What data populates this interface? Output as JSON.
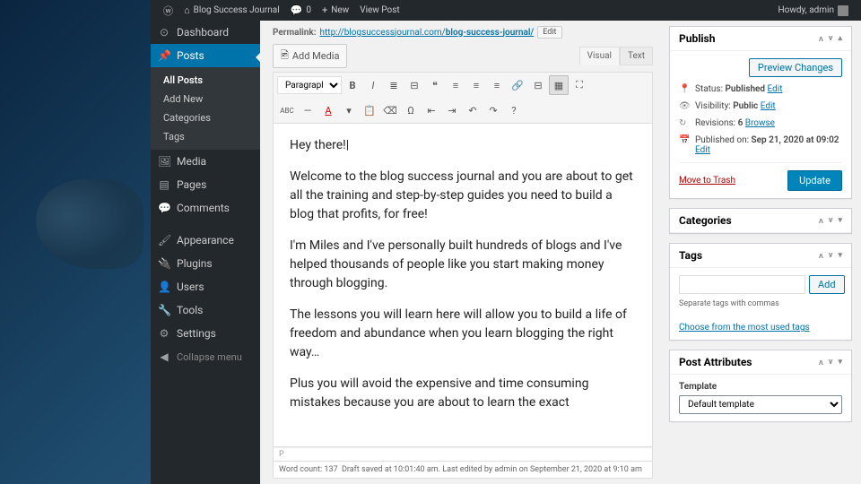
{
  "adminbar": {
    "site": "Blog Success Journal",
    "comments": "0",
    "new": "New",
    "view": "View Post",
    "howdy": "Howdy, admin"
  },
  "sidebar": {
    "dashboard": "Dashboard",
    "posts": "Posts",
    "allposts": "All Posts",
    "addnew": "Add New",
    "categories": "Categories",
    "tagssub": "Tags",
    "media": "Media",
    "pages": "Pages",
    "comments": "Comments",
    "appearance": "Appearance",
    "plugins": "Plugins",
    "users": "Users",
    "tools": "Tools",
    "settings": "Settings",
    "collapse": "Collapse menu"
  },
  "permalink": {
    "label": "Permalink:",
    "base": "http://blogsuccessjournal.com/",
    "slug": "blog-success-journal/",
    "edit": "Edit"
  },
  "mediabtn": "Add Media",
  "tabs": {
    "visual": "Visual",
    "text": "Text"
  },
  "format_select": "Paragraph",
  "post": {
    "p1": "Hey there!",
    "p2": "Welcome to the blog success journal and you are about to get all the training and step-by-step guides you need to build a blog that profits, for free!",
    "p3": "I'm Miles and I've personally built hundreds of blogs and I've helped thousands of people like you start making money through blogging.",
    "p4": "The lessons you will learn here will allow you to build a life of freedom and abundance when you learn blogging the right way…",
    "p5": "Plus you will avoid the expensive and time consuming mistakes because you are about to learn the exact"
  },
  "pathbar": "P",
  "wordcount": {
    "label": "Word count:",
    "value": "137"
  },
  "draftstatus": "Draft saved at 10:01:40 am. Last edited by admin on September 21, 2020 at 9:10 am",
  "publish": {
    "title": "Publish",
    "preview": "Preview Changes",
    "status_l": "Status: ",
    "status_v": "Published",
    "status_e": "Edit",
    "vis_l": "Visibility: ",
    "vis_v": "Public",
    "vis_e": "Edit",
    "rev_l": "Revisions: ",
    "rev_v": "6",
    "rev_b": "Browse",
    "pub_l": "Published on: ",
    "pub_v": "Sep 21, 2020 at 09:02",
    "pub_e": "Edit",
    "trash": "Move to Trash",
    "update": "Update"
  },
  "categories": {
    "title": "Categories"
  },
  "tags": {
    "title": "Tags",
    "add": "Add",
    "hint": "Separate tags with commas",
    "choose": "Choose from the most used tags"
  },
  "attrs": {
    "title": "Post Attributes",
    "tmpl_label": "Template",
    "tmpl_value": "Default template"
  }
}
